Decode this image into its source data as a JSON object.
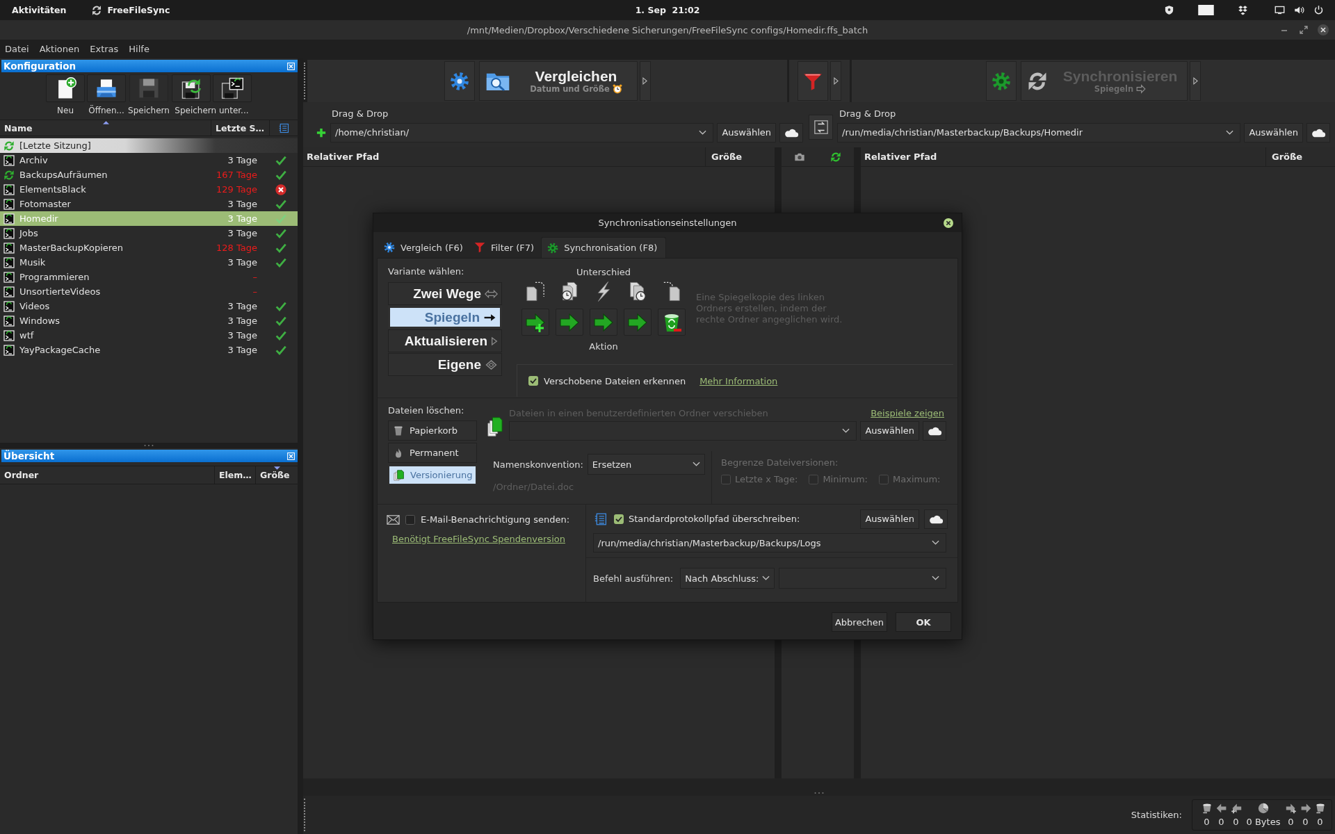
{
  "top_bar": {
    "activities": "Aktivitäten",
    "app_name": "FreeFileSync",
    "clock": "1. Sep  21:02"
  },
  "window": {
    "title": "/mnt/Medien/Dropbox/Verschiedene Sicherungen/FreeFileSync configs/Homedir.ffs_batch"
  },
  "menu": [
    "Datei",
    "Aktionen",
    "Extras",
    "Hilfe"
  ],
  "config_panel": {
    "title": "Konfiguration",
    "toolbar": [
      {
        "label": "Neu",
        "kind": "new",
        "disabled": false
      },
      {
        "label": "Öffnen...",
        "kind": "open",
        "disabled": false
      },
      {
        "label": "Speichern",
        "kind": "save",
        "disabled": true
      },
      {
        "label": "Speichern unter...",
        "kind": "save_as",
        "disabled": false
      }
    ],
    "columns": [
      {
        "label": "Name",
        "sorted": true,
        "descending": false
      },
      {
        "label": "Letzte S…",
        "sorted": false
      }
    ],
    "rows": [
      {
        "name": "[Letzte Sitzung]",
        "kind": "last_session",
        "selected": false
      },
      {
        "name": "Archiv",
        "kind": "batch",
        "age": "3 Tage",
        "overdue": false,
        "synced": true,
        "failed": false,
        "selected": false
      },
      {
        "name": "BackupsAufräumen",
        "kind": "gui",
        "age": "167 Tage",
        "overdue": true,
        "synced": true,
        "failed": false,
        "selected": false
      },
      {
        "name": "ElementsBlack",
        "kind": "batch",
        "age": "129 Tage",
        "overdue": true,
        "synced": false,
        "failed": true,
        "selected": false
      },
      {
        "name": "Fotomaster",
        "kind": "batch",
        "age": "3 Tage",
        "overdue": false,
        "synced": true,
        "failed": false,
        "selected": false
      },
      {
        "name": "Homedir",
        "kind": "batch",
        "age": "3 Tage",
        "overdue": false,
        "synced": true,
        "failed": false,
        "selected": true
      },
      {
        "name": "Jobs",
        "kind": "batch",
        "age": "3 Tage",
        "overdue": false,
        "synced": true,
        "failed": false,
        "selected": false
      },
      {
        "name": "MasterBackupKopieren",
        "kind": "batch",
        "age": "128 Tage",
        "overdue": true,
        "synced": true,
        "failed": false,
        "selected": false
      },
      {
        "name": "Musik",
        "kind": "batch",
        "age": "3 Tage",
        "overdue": false,
        "synced": true,
        "failed": false,
        "selected": false
      },
      {
        "name": "Programmieren",
        "kind": "batch",
        "age": "–",
        "overdue": true,
        "synced": false,
        "failed": false,
        "selected": false
      },
      {
        "name": "UnsortierteVideos",
        "kind": "batch",
        "age": "–",
        "overdue": true,
        "synced": false,
        "failed": false,
        "selected": false
      },
      {
        "name": "Videos",
        "kind": "batch",
        "age": "3 Tage",
        "overdue": false,
        "synced": true,
        "failed": false,
        "selected": false
      },
      {
        "name": "Windows",
        "kind": "batch",
        "age": "3 Tage",
        "overdue": false,
        "synced": true,
        "failed": false,
        "selected": false
      },
      {
        "name": "wtf",
        "kind": "batch",
        "age": "3 Tage",
        "overdue": false,
        "synced": true,
        "failed": false,
        "selected": false
      },
      {
        "name": "YayPackageCache",
        "kind": "batch",
        "age": "3 Tage",
        "overdue": false,
        "synced": true,
        "failed": false,
        "selected": false
      }
    ]
  },
  "overview_panel": {
    "title": "Übersicht",
    "columns": [
      {
        "label": "Ordner",
        "sorted": false
      },
      {
        "label": "Elem…",
        "sorted": false
      },
      {
        "label": "Größe",
        "sorted": true,
        "descending": true
      }
    ]
  },
  "main_toolbar": {
    "compare": {
      "label": "Vergleichen",
      "variant": "Datum und Größe",
      "disabled": false
    },
    "sync": {
      "label": "Synchronisieren",
      "variant": "Spiegeln",
      "disabled": true
    }
  },
  "left_folder": {
    "label": "Drag & Drop",
    "path": "/home/christian/",
    "browse": "Auswählen"
  },
  "right_folder": {
    "label": "Drag & Drop",
    "path": "/run/media/christian/Masterbackup/Backups/Homedir",
    "browse": "Auswählen"
  },
  "file_grid": {
    "left_columns": [
      "Relativer Pfad",
      "Größe"
    ],
    "right_columns": [
      "Relativer Pfad",
      "Größe"
    ]
  },
  "status_bar": {
    "label": "Statistiken:",
    "stats": [
      {
        "kind": "delete_left",
        "value": "0"
      },
      {
        "kind": "update_left",
        "value": "0"
      },
      {
        "kind": "create_left",
        "value": "0"
      },
      {
        "kind": "data",
        "value": "0 Bytes"
      },
      {
        "kind": "create_right",
        "value": "0"
      },
      {
        "kind": "update_right",
        "value": "0"
      },
      {
        "kind": "delete_right",
        "value": "0"
      }
    ]
  },
  "dialog": {
    "title": "Synchronisationseinstellungen",
    "tabs": [
      {
        "label": "Vergleich (F6)",
        "kind": "compare",
        "selected": false
      },
      {
        "label": "Filter (F7)",
        "kind": "filter",
        "selected": false
      },
      {
        "label": "Synchronisation (F8)",
        "kind": "sync",
        "selected": true
      }
    ],
    "variant_label": "Variante wählen:",
    "variants": [
      {
        "label": "Zwei Wege",
        "kind": "two_way",
        "selected": false
      },
      {
        "label": "Spiegeln",
        "kind": "mirror",
        "selected": true
      },
      {
        "label": "Aktualisieren",
        "kind": "update",
        "selected": false
      },
      {
        "label": "Eigene",
        "kind": "custom",
        "selected": false
      }
    ],
    "difference_label": "Unterschied",
    "actions": [
      {
        "kind": "create_right"
      },
      {
        "kind": "update_right"
      },
      {
        "kind": "update_right"
      },
      {
        "kind": "update_right"
      },
      {
        "kind": "delete_right"
      }
    ],
    "action_label": "Aktion",
    "description": "Eine Spiegelkopie des linken Ordners erstellen, indem der rechte Ordner angeglichen wird.",
    "detect_moved": {
      "label": "Verschobene Dateien erkennen",
      "checked": true,
      "link": "Mehr Information"
    },
    "delete_label": "Dateien löschen:",
    "delete_options": [
      {
        "label": "Papierkorb",
        "kind": "recycler",
        "selected": false
      },
      {
        "label": "Permanent",
        "kind": "permanent",
        "selected": false
      },
      {
        "label": "Versionierung",
        "kind": "versioning",
        "selected": true
      }
    ],
    "versioning": {
      "hint": "Dateien in einen benutzerdefinierten Ordner verschieben",
      "examples_link": "Beispiele zeigen",
      "browse": "Auswählen",
      "naming_label": "Namenskonvention:",
      "naming": "Ersetzen",
      "example_path": "/Ordner/Datei.doc",
      "limit_label": "Begrenze Dateiversionen:",
      "limits_disabled": true,
      "limits": [
        {
          "label": "Letzte x Tage:",
          "checked": false
        },
        {
          "label": "Minimum:",
          "checked": false
        },
        {
          "label": "Maximum:",
          "checked": false
        }
      ]
    },
    "email": {
      "label": "E-Mail-Benachrichtigung senden:",
      "checked": false,
      "link": "Benötigt FreeFileSync Spendenversion"
    },
    "log": {
      "label": "Standardprotokollpfad überschreiben:",
      "checked": true,
      "browse": "Auswählen",
      "path": "/run/media/christian/Masterbackup/Backups/Logs"
    },
    "command": {
      "label": "Befehl ausführen:",
      "when": "Nach Abschluss:"
    },
    "buttons": [
      {
        "label": "Abbrechen",
        "kind": "cancel"
      },
      {
        "label": "OK",
        "kind": "ok"
      }
    ]
  }
}
